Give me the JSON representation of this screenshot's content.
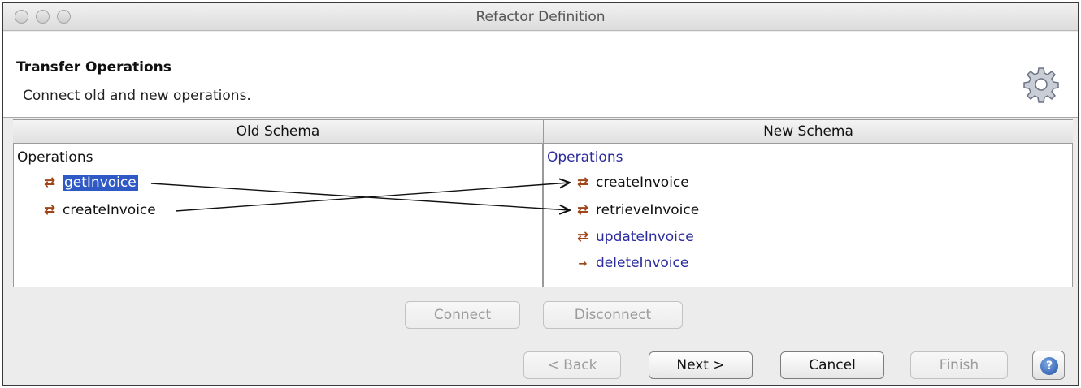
{
  "window": {
    "title": "Refactor Definition"
  },
  "header": {
    "title": "Transfer Operations",
    "description": "Connect old and new operations.",
    "icon": "gear-icon"
  },
  "old_schema": {
    "heading": "Old Schema",
    "root_label": "Operations",
    "items": [
      {
        "label": "getInvoice",
        "selected": true,
        "icon": "operation-icon"
      },
      {
        "label": "createInvoice",
        "selected": false,
        "icon": "operation-icon"
      }
    ]
  },
  "new_schema": {
    "heading": "New Schema",
    "root_label": "Operations",
    "items": [
      {
        "label": "createInvoice",
        "icon": "operation-icon",
        "mapped": true
      },
      {
        "label": "retrieveInvoice",
        "icon": "operation-icon",
        "mapped": true
      },
      {
        "label": "updateInvoice",
        "icon": "operation-icon",
        "mapped": false
      },
      {
        "label": "deleteInvoice",
        "icon": "arrow-icon",
        "mapped": false
      }
    ]
  },
  "actions": {
    "connect": "Connect",
    "disconnect": "Disconnect"
  },
  "footer": {
    "back": "< Back",
    "next": "Next >",
    "cancel": "Cancel",
    "finish": "Finish",
    "help_glyph": "?"
  }
}
